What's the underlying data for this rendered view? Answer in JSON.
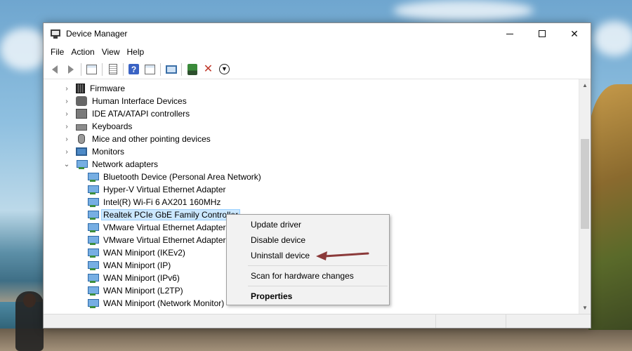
{
  "window": {
    "title": "Device Manager",
    "controls": {
      "minimize": "minimize",
      "maximize": "maximize",
      "close": "✕"
    }
  },
  "menubar": {
    "items": [
      "File",
      "Action",
      "View",
      "Help"
    ]
  },
  "toolbar": {
    "icons": [
      "back-arrow-icon",
      "forward-arrow-icon",
      "properties-pane-icon",
      "driver-details-icon",
      "help-icon",
      "action-pane-icon",
      "monitor-icon",
      "scan-hardware-icon",
      "uninstall-icon",
      "update-driver-icon"
    ]
  },
  "tree": {
    "categories": [
      {
        "label": "Firmware",
        "icon": "chip",
        "expanded": false
      },
      {
        "label": "Human Interface Devices",
        "icon": "hid",
        "expanded": false
      },
      {
        "label": "IDE ATA/ATAPI controllers",
        "icon": "ide",
        "expanded": false
      },
      {
        "label": "Keyboards",
        "icon": "kbd",
        "expanded": false
      },
      {
        "label": "Mice and other pointing devices",
        "icon": "mouse",
        "expanded": false
      },
      {
        "label": "Monitors",
        "icon": "monitor",
        "expanded": false
      },
      {
        "label": "Network adapters",
        "icon": "net",
        "expanded": true
      }
    ],
    "network_adapters": [
      "Bluetooth Device (Personal Area Network)",
      "Hyper-V Virtual Ethernet Adapter",
      "Intel(R) Wi-Fi 6 AX201 160MHz",
      "Realtek PCIe GbE Family Controller",
      "VMware Virtual Ethernet Adapter f",
      "VMware Virtual Ethernet Adapter f",
      "WAN Miniport (IKEv2)",
      "WAN Miniport (IP)",
      "WAN Miniport (IPv6)",
      "WAN Miniport (L2TP)",
      "WAN Miniport (Network Monitor)"
    ],
    "selected_adapter": "Realtek PCIe GbE Family Controller"
  },
  "context_menu": {
    "update_driver": "Update driver",
    "disable_device": "Disable device",
    "uninstall_device": "Uninstall device",
    "scan_hardware": "Scan for hardware changes",
    "properties": "Properties"
  },
  "colors": {
    "selection": "#cce8ff",
    "annotation_arrow": "#8b3a3a"
  }
}
